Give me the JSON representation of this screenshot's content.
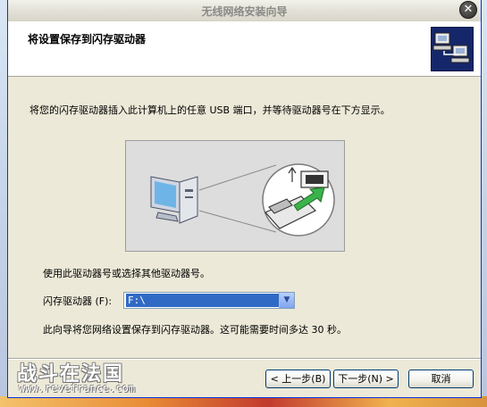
{
  "window": {
    "title": "无线网络安装向导",
    "close_label": "✕"
  },
  "header": {
    "title": "将设置保存到闪存驱动器",
    "icon": "network-computers-icon"
  },
  "intro_text": "将您的闪存驱动器插入此计算机上的任意 USB 端口，并等待驱动器号在下方显示。",
  "illustration": {
    "icon": "computer-to-usb-drive-illustration"
  },
  "drive": {
    "use_text": "使用此驱动器号或选择其他驱动器号。",
    "label": "闪存驱动器 (F):",
    "value": "F:\\"
  },
  "info_text": "此向导将您网络设置保存到闪存驱动器。这可能需要时间多达 30 秒。",
  "buttons": {
    "back": "< 上一步(B)",
    "next": "下一步(N) >",
    "cancel": "取消"
  },
  "watermark": {
    "line1": "战斗在法国",
    "line2": "www.revefrance.com"
  },
  "colors": {
    "selection": "#316ac5",
    "title_bar": "#e3e1d7",
    "dialog_bg": "#ece9d8",
    "header_icon_bg": "#15276a"
  }
}
